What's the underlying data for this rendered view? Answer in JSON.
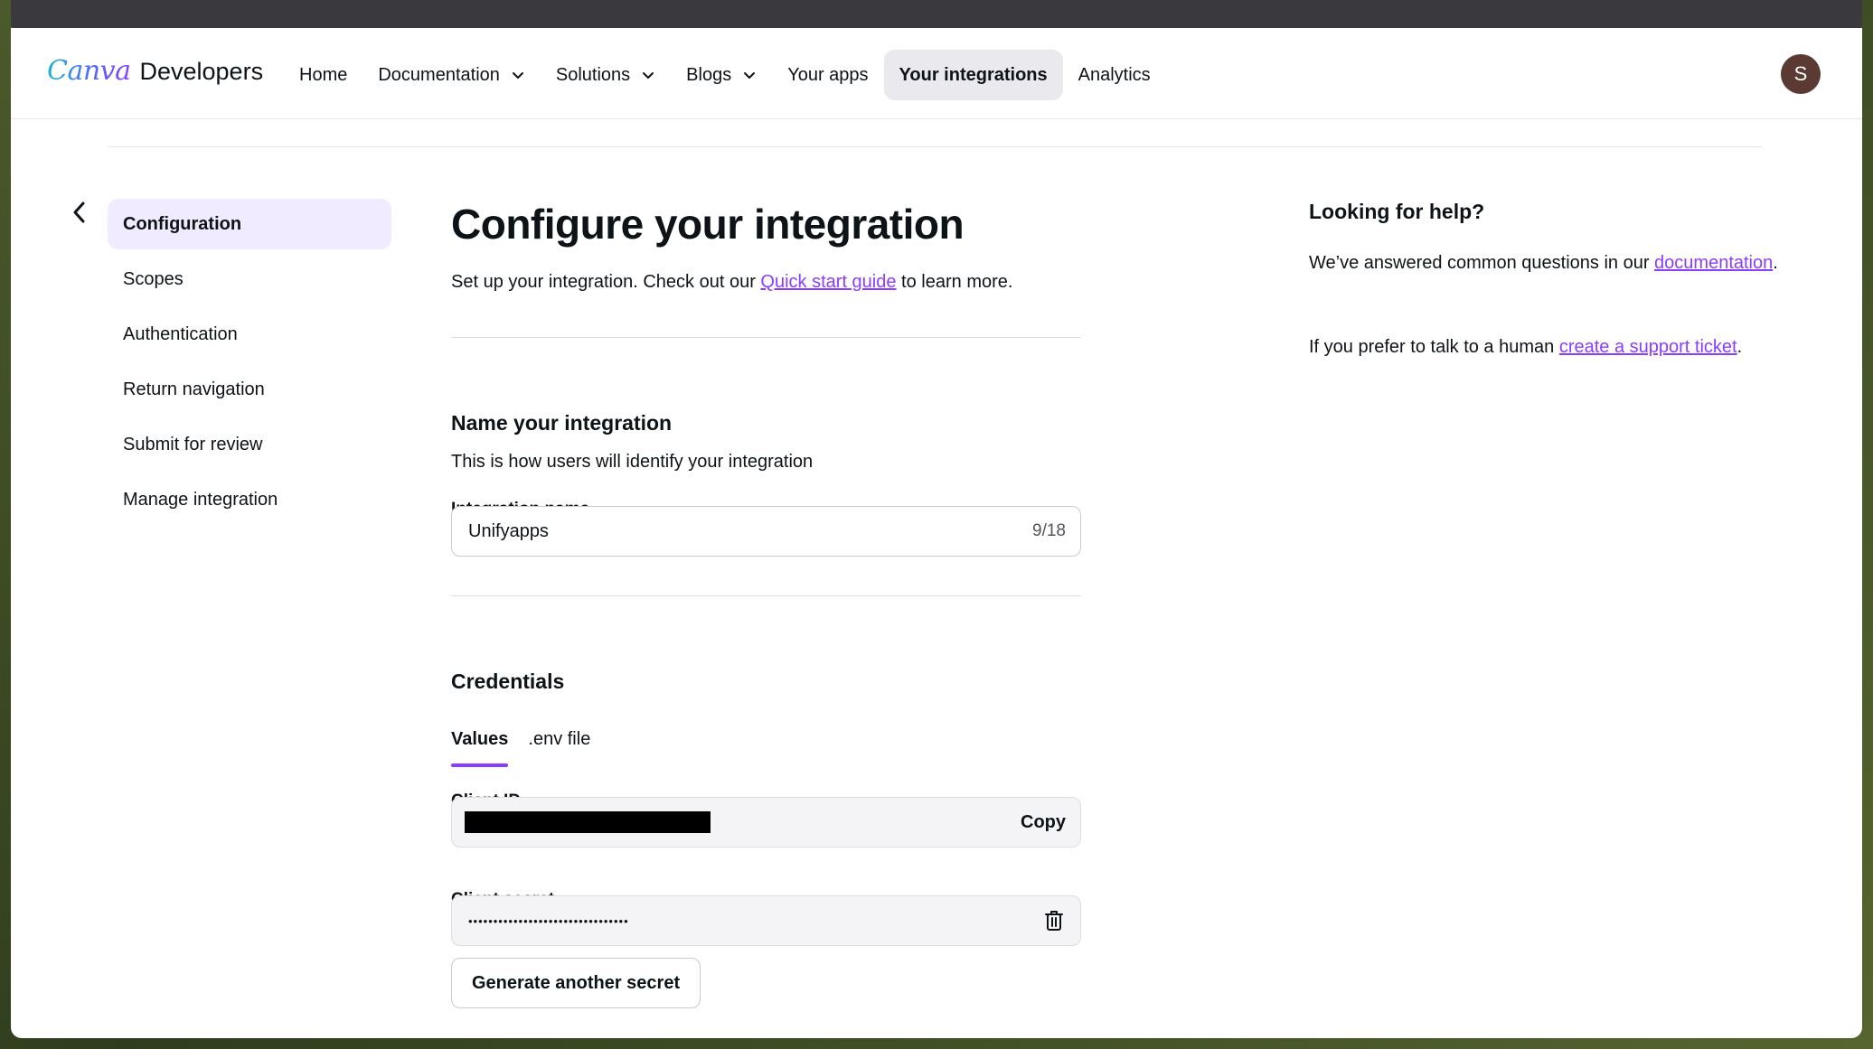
{
  "brand": {
    "canva": "Canva",
    "developers": "Developers"
  },
  "nav": {
    "items": [
      {
        "label": "Home",
        "dropdown": false
      },
      {
        "label": "Documentation",
        "dropdown": true
      },
      {
        "label": "Solutions",
        "dropdown": true
      },
      {
        "label": "Blogs",
        "dropdown": true
      },
      {
        "label": "Your apps",
        "dropdown": false
      },
      {
        "label": "Your integrations",
        "dropdown": false,
        "active": true
      },
      {
        "label": "Analytics",
        "dropdown": false
      }
    ],
    "avatar_initial": "S"
  },
  "sidebar": {
    "items": [
      {
        "label": "Configuration",
        "active": true
      },
      {
        "label": "Scopes"
      },
      {
        "label": "Authentication"
      },
      {
        "label": "Return navigation"
      },
      {
        "label": "Submit for review"
      },
      {
        "label": "Manage integration"
      }
    ]
  },
  "main": {
    "title": "Configure your integration",
    "lead_before": "Set up your integration. Check out our ",
    "lead_link": "Quick start guide",
    "lead_after": " to learn more.",
    "name_section": {
      "heading": "Name your integration",
      "description": "This is how users will identify your integration",
      "field_label": "Integration name",
      "field_value": "Unifyapps",
      "counter": "9/18"
    },
    "credentials": {
      "heading": "Credentials",
      "tabs": [
        "Values",
        ".env file"
      ],
      "client_id_label": "Client ID",
      "copy_label": "Copy",
      "client_secret_label": "Client secret",
      "client_secret_masked": "••••••••••••••••••••••••••••••••",
      "generate_label": "Generate another secret"
    }
  },
  "help": {
    "title": "Looking for help?",
    "p1_before": "We’ve answered common questions in our ",
    "p1_link": "documentation",
    "p1_after": ".",
    "p2_before": "If you prefer to talk to a human ",
    "p2_link": "create a support ticket",
    "p2_after": "."
  },
  "colors": {
    "accent": "#8b3dff",
    "active_nav_bg": "#e9e9ee",
    "active_side_bg": "#f1ebff"
  }
}
